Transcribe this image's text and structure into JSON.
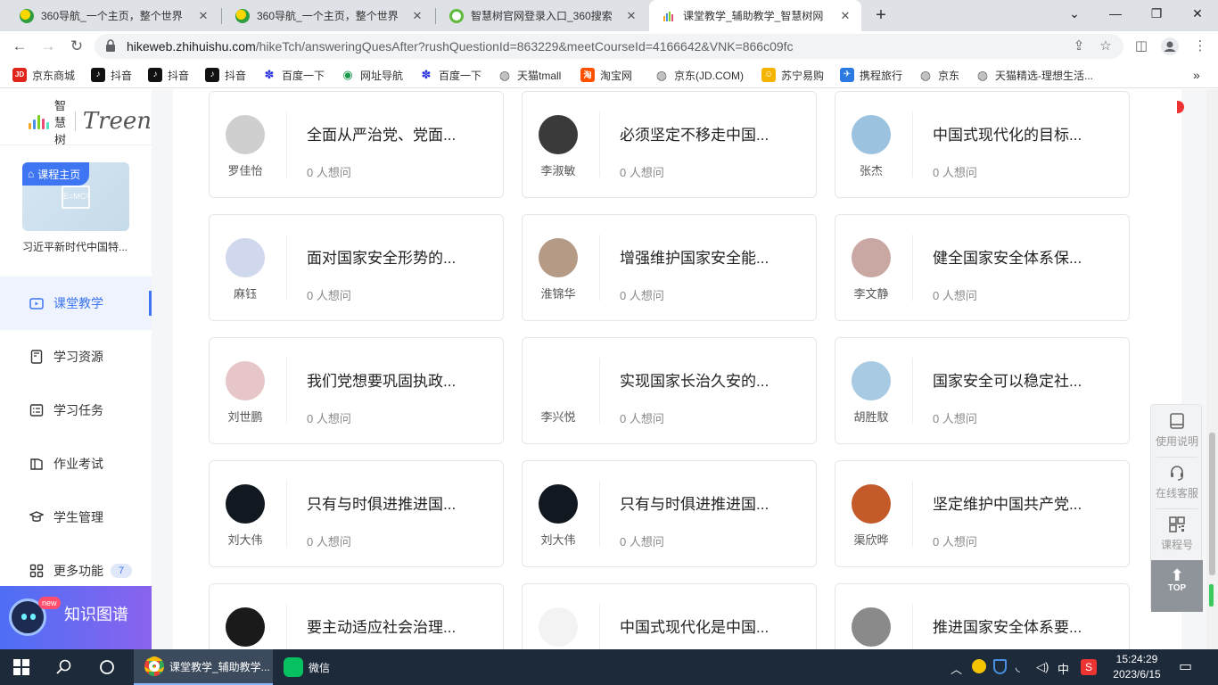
{
  "browser": {
    "tabs": [
      {
        "title": "360导航_一个主页，整个世界",
        "favicon": "360-nav-icon"
      },
      {
        "title": "360导航_一个主页，整个世界",
        "favicon": "360-nav-icon"
      },
      {
        "title": "智慧树官网登录入口_360搜索",
        "favicon": "360-search-icon"
      },
      {
        "title": "课堂教学_辅助教学_智慧树网",
        "favicon": "zhihuishu-icon",
        "active": true
      }
    ],
    "new_tab": "+",
    "window": {
      "minimize": "⌄",
      "min": "—",
      "restore": "❐",
      "close": "✕"
    },
    "url_host": "hikeweb.zhihuishu.com",
    "url_path": "/hikeTch/answeringQuesAfter?rushQuestionId=863229&meetCourseId=4166642&VNK=866c09fc"
  },
  "bookmarks": [
    {
      "label": "京东商城",
      "icon": "jd-icon",
      "color": "#e1251b",
      "glyph": "JD"
    },
    {
      "label": "抖音",
      "icon": "douyin-icon",
      "color": "#111",
      "glyph": "♪"
    },
    {
      "label": "抖音",
      "icon": "douyin-icon",
      "color": "#111",
      "glyph": "♪"
    },
    {
      "label": "抖音",
      "icon": "douyin-icon",
      "color": "#111",
      "glyph": "♪"
    },
    {
      "label": "百度一下",
      "icon": "baidu-icon",
      "color": "#2932e1",
      "glyph": "✽"
    },
    {
      "label": "网址导航",
      "icon": "nav-icon",
      "color": "#1c9a4b",
      "glyph": "◉"
    },
    {
      "label": "百度一下",
      "icon": "baidu-icon",
      "color": "#2932e1",
      "glyph": "✽"
    },
    {
      "label": "天猫tmall",
      "icon": "globe-icon",
      "color": "#666",
      "glyph": "◍"
    },
    {
      "label": "淘宝网",
      "icon": "taobao-icon",
      "color": "#ff5000",
      "glyph": "淘"
    },
    {
      "label": "京东(JD.COM)",
      "icon": "globe-icon",
      "color": "#666",
      "glyph": "◍"
    },
    {
      "label": "苏宁易购",
      "icon": "suning-icon",
      "color": "#f5b400",
      "glyph": "☺"
    },
    {
      "label": "携程旅行",
      "icon": "ctrip-icon",
      "color": "#2a7ae2",
      "glyph": "✈"
    },
    {
      "label": "京东",
      "icon": "globe-icon",
      "color": "#666",
      "glyph": "◍"
    },
    {
      "label": "天猫精选-理想生活...",
      "icon": "globe-icon",
      "color": "#666",
      "glyph": "◍"
    }
  ],
  "bookmarks_more": "»",
  "sidebar": {
    "brand": "智慧树",
    "brand_en": "Treen",
    "course_home": "课程主页",
    "course_thumb_text": "E=MC²",
    "course_name": "习近平新时代中国特...",
    "menu": [
      {
        "label": "课堂教学",
        "icon": "classroom-icon",
        "active": true
      },
      {
        "label": "学习资源",
        "icon": "resource-icon"
      },
      {
        "label": "学习任务",
        "icon": "task-icon"
      },
      {
        "label": "作业考试",
        "icon": "exam-icon"
      },
      {
        "label": "学生管理",
        "icon": "student-icon"
      },
      {
        "label": "更多功能",
        "icon": "more-icon",
        "badge": "7"
      }
    ],
    "knowledge_graph": {
      "label": "知识图谱",
      "badge": "new"
    }
  },
  "questions": [
    {
      "user": "罗佳怡",
      "title": "全面从严治党、党面...",
      "count": "0 人想问",
      "avatar_color": "#cfcfcf"
    },
    {
      "user": "李淑敏",
      "title": "必须坚定不移走中国...",
      "count": "0 人想问",
      "avatar_color": "#3a3a3a"
    },
    {
      "user": "张杰",
      "title": "中国式现代化的目标...",
      "count": "0 人想问",
      "avatar_color": "#9bc3df"
    },
    {
      "user": "麻钰",
      "title": "面对国家安全形势的...",
      "count": "0 人想问",
      "avatar_color": "#cfd8ec"
    },
    {
      "user": "淮锦华",
      "title": "增强维护国家安全能...",
      "count": "0 人想问",
      "avatar_color": "#b59a86"
    },
    {
      "user": "李文静",
      "title": "健全国家安全体系保...",
      "count": "0 人想问",
      "avatar_color": "#c9a7a3"
    },
    {
      "user": "刘世鹏",
      "title": "我们党想要巩固执政...",
      "count": "0 人想问",
      "avatar_color": "#e6c6c8"
    },
    {
      "user": "李兴悦",
      "title": "实现国家长治久安的...",
      "count": "0 人想问",
      "avatar_color": "#ffffff"
    },
    {
      "user": "胡胜馼",
      "title": "国家安全可以稳定社...",
      "count": "0 人想问",
      "avatar_color": "#a8cbe3"
    },
    {
      "user": "刘大伟",
      "title": "只有与时俱进推进国...",
      "count": "0 人想问",
      "avatar_color": "#111820"
    },
    {
      "user": "刘大伟",
      "title": "只有与时俱进推进国...",
      "count": "0 人想问",
      "avatar_color": "#111820"
    },
    {
      "user": "渠欣晔",
      "title": "坚定维护中国共产党...",
      "count": "0 人想问",
      "avatar_color": "#c45a2a"
    },
    {
      "user": "",
      "title": "要主动适应社会治理...",
      "count": "",
      "avatar_color": "#1a1a1a"
    },
    {
      "user": "",
      "title": "中国式现代化是中国...",
      "count": "",
      "avatar_color": "#f3f3f3"
    },
    {
      "user": "",
      "title": "推进国家安全体系要...",
      "count": "",
      "avatar_color": "#8a8a8a"
    }
  ],
  "float_tools": [
    {
      "label": "使用说明",
      "icon": "book-icon"
    },
    {
      "label": "在线客服",
      "icon": "headset-icon"
    },
    {
      "label": "课程号",
      "icon": "qrcode-icon"
    }
  ],
  "float_top": "TOP",
  "taskbar": {
    "apps": [
      {
        "label": "课堂教学_辅助教学...",
        "icon": "chrome-icon",
        "active": true
      },
      {
        "label": "微信",
        "icon": "wechat-icon"
      }
    ],
    "ime": "中",
    "time": "15:24:29",
    "date": "2023/6/15"
  },
  "colors": {
    "accent": "#3d75f2",
    "taskbar": "#1c2a3a"
  }
}
